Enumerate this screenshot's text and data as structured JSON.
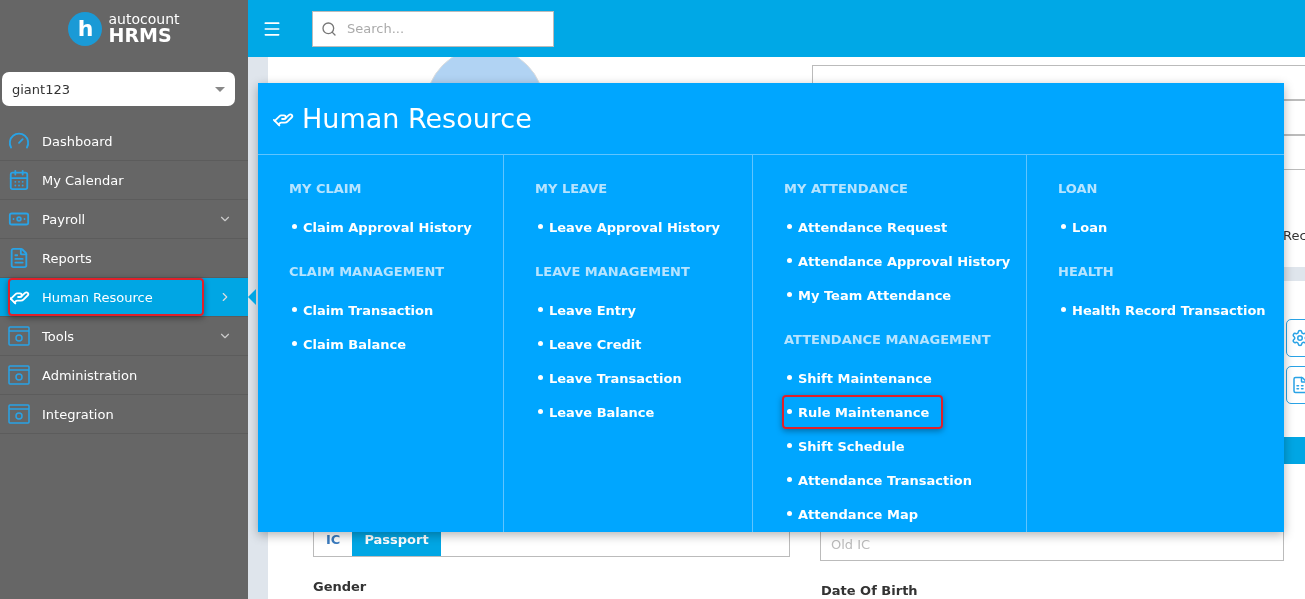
{
  "brand": {
    "prefix": "auto",
    "name": "count",
    "product": "HRMS",
    "mark": "h"
  },
  "company_select": {
    "value": "giant123"
  },
  "sidebar": {
    "items": [
      {
        "label": "Dashboard",
        "selected": false,
        "highlighted": false
      },
      {
        "label": "My Calendar",
        "selected": false,
        "highlighted": false
      },
      {
        "label": "Payroll",
        "selected": false,
        "highlighted": false,
        "has_submenu": true
      },
      {
        "label": "Reports",
        "selected": false,
        "highlighted": false
      },
      {
        "label": "Human Resource",
        "selected": true,
        "highlighted": true,
        "has_submenu": true
      },
      {
        "label": "Tools",
        "selected": false,
        "highlighted": false,
        "has_submenu": true
      },
      {
        "label": "Administration",
        "selected": false,
        "highlighted": false
      },
      {
        "label": "Integration",
        "selected": false,
        "highlighted": false
      }
    ]
  },
  "search": {
    "placeholder": "Search..."
  },
  "form": {
    "cut_text": "Rec",
    "id_types": [
      {
        "label": "IC",
        "selected": false
      },
      {
        "label": "Passport",
        "selected": true
      }
    ],
    "old_ic": {
      "placeholder": "Old IC"
    },
    "gender_label": "Gender",
    "dob_label": "Date Of Birth"
  },
  "mega_menu": {
    "title": "Human Resource",
    "columns": [
      {
        "sections": [
          {
            "title": "MY CLAIM",
            "links": [
              {
                "label": "Claim Approval History",
                "highlighted": false
              }
            ]
          },
          {
            "title": "CLAIM MANAGEMENT",
            "links": [
              {
                "label": "Claim Transaction",
                "highlighted": false
              },
              {
                "label": "Claim Balance",
                "highlighted": false
              }
            ]
          }
        ]
      },
      {
        "sections": [
          {
            "title": "MY LEAVE",
            "links": [
              {
                "label": "Leave Approval History",
                "highlighted": false
              }
            ]
          },
          {
            "title": "LEAVE MANAGEMENT",
            "links": [
              {
                "label": "Leave Entry",
                "highlighted": false
              },
              {
                "label": "Leave Credit",
                "highlighted": false
              },
              {
                "label": "Leave Transaction",
                "highlighted": false
              },
              {
                "label": "Leave Balance",
                "highlighted": false
              }
            ]
          }
        ]
      },
      {
        "sections": [
          {
            "title": "MY ATTENDANCE",
            "links": [
              {
                "label": "Attendance Request",
                "highlighted": false
              },
              {
                "label": "Attendance Approval History",
                "highlighted": false
              },
              {
                "label": "My Team Attendance",
                "highlighted": false
              }
            ]
          },
          {
            "title": "ATTENDANCE MANAGEMENT",
            "links": [
              {
                "label": "Shift Maintenance",
                "highlighted": false
              },
              {
                "label": "Rule Maintenance",
                "highlighted": true
              },
              {
                "label": "Shift Schedule",
                "highlighted": false
              },
              {
                "label": "Attendance Transaction",
                "highlighted": false
              },
              {
                "label": "Attendance Map",
                "highlighted": false
              }
            ]
          }
        ]
      },
      {
        "sections": [
          {
            "title": "LOAN",
            "links": [
              {
                "label": "Loan",
                "highlighted": false
              }
            ]
          },
          {
            "title": "HEALTH",
            "links": [
              {
                "label": "Health Record Transaction",
                "highlighted": false
              }
            ]
          }
        ]
      }
    ]
  }
}
